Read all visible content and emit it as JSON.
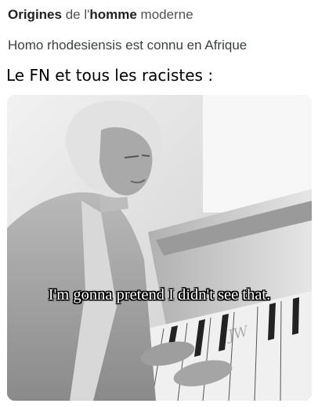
{
  "search_result": {
    "title_word1": "Origines",
    "title_word2": " de l'",
    "title_word3": "homme",
    "title_word4": " moderne",
    "snippet": "Homo rhodesiensis est connu en Afrique"
  },
  "meme": {
    "caption": "Le FN et tous les racistes :",
    "overlay_text": "I'm gonna pretend I didn't see that.",
    "watermark": "JW"
  }
}
